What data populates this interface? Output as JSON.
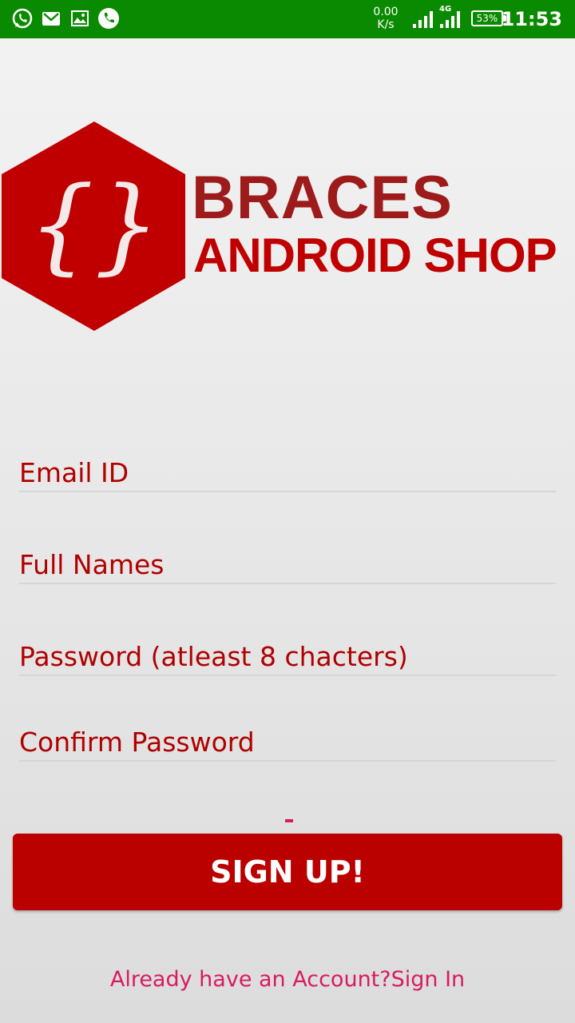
{
  "status_bar": {
    "icons": [
      "whatsapp-icon",
      "gmail-icon",
      "image-icon",
      "phone-icon"
    ],
    "net_speed_value": "0.00",
    "net_speed_unit": "K/s",
    "network_type": "4G",
    "battery": "53%",
    "time": "11:53",
    "color": "#0a8a00"
  },
  "logo": {
    "line1": "BRACES",
    "line2": "ANDROID SHOP",
    "symbol": "{}",
    "color": "#c00000"
  },
  "form": {
    "email_placeholder": "Email ID",
    "fullname_placeholder": "Full Names",
    "password_placeholder": "Password (atleast 8 chacters)",
    "confirm_placeholder": "Confirm Password"
  },
  "signup_button": "SIGN UP!",
  "signin_link": "Already have an Account?Sign In",
  "colors": {
    "accent": "#bb0000",
    "link": "#d81b60"
  }
}
